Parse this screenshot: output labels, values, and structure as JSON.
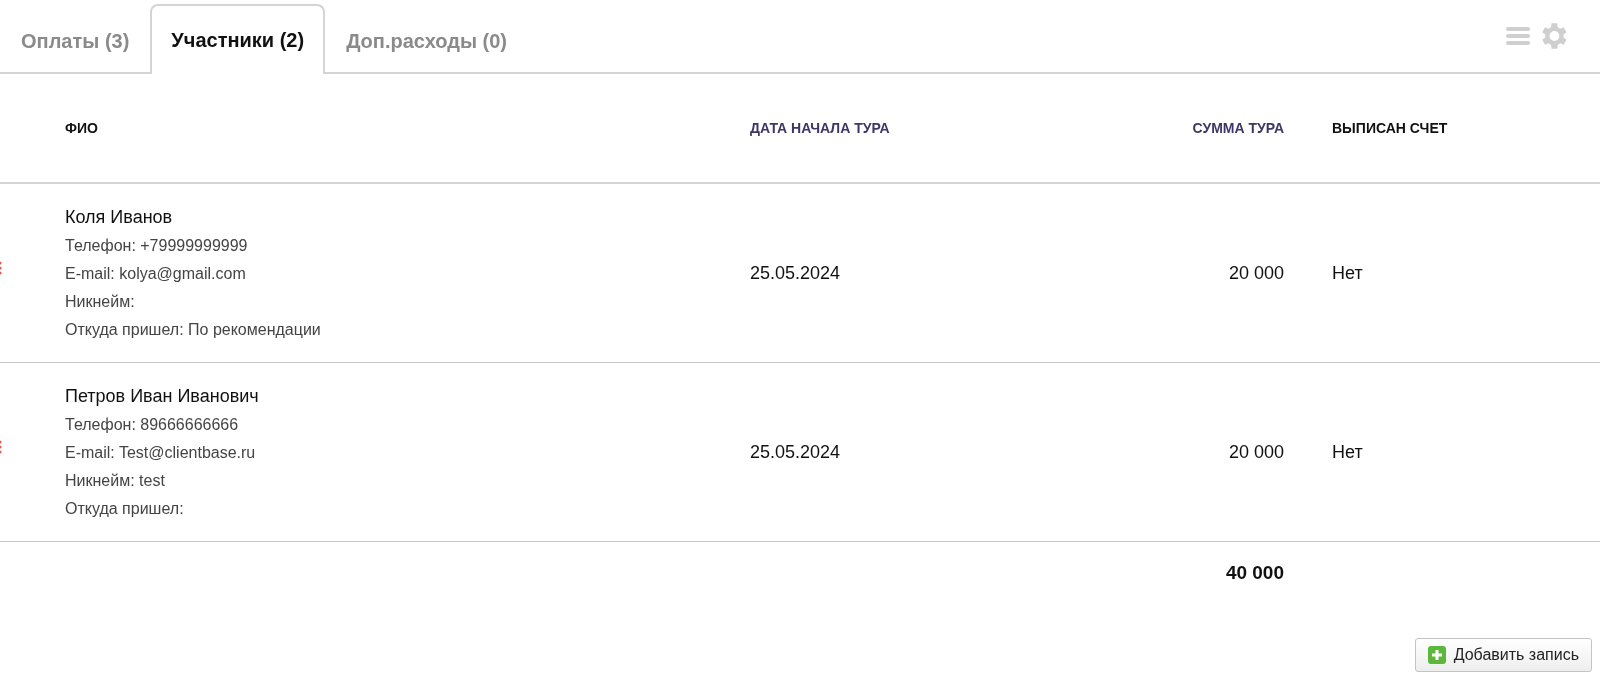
{
  "tabs": [
    {
      "label": "Оплаты (3)",
      "selected": false
    },
    {
      "label": "Участники  (2)",
      "selected": true
    },
    {
      "label": "Доп.расходы (0)",
      "selected": false
    }
  ],
  "table": {
    "columns": [
      {
        "label": "ФИО",
        "accent": false
      },
      {
        "label": "ДАТА НАЧАЛА ТУРА",
        "accent": true
      },
      {
        "label": "СУММА ТУРА",
        "accent": true
      },
      {
        "label": "ВЫПИСАН СЧЕТ",
        "accent": false
      }
    ],
    "rows": [
      {
        "name": "Коля Иванов",
        "details": [
          "Телефон: +79999999999",
          "E-mail: kolya@gmail.com",
          "Никнейм:",
          "Откуда пришел: По рекомендации"
        ],
        "date": "25.05.2024",
        "sum": "20 000",
        "invoiced": "Нет"
      },
      {
        "name": "Петров Иван Иванович",
        "details": [
          "Телефон: 89666666666",
          "E-mail: Test@clientbase.ru",
          "Никнейм: test",
          "Откуда пришел:"
        ],
        "date": "25.05.2024",
        "sum": "20 000",
        "invoiced": "Нет"
      }
    ],
    "total": "40 000"
  },
  "add_button": "Добавить запись"
}
